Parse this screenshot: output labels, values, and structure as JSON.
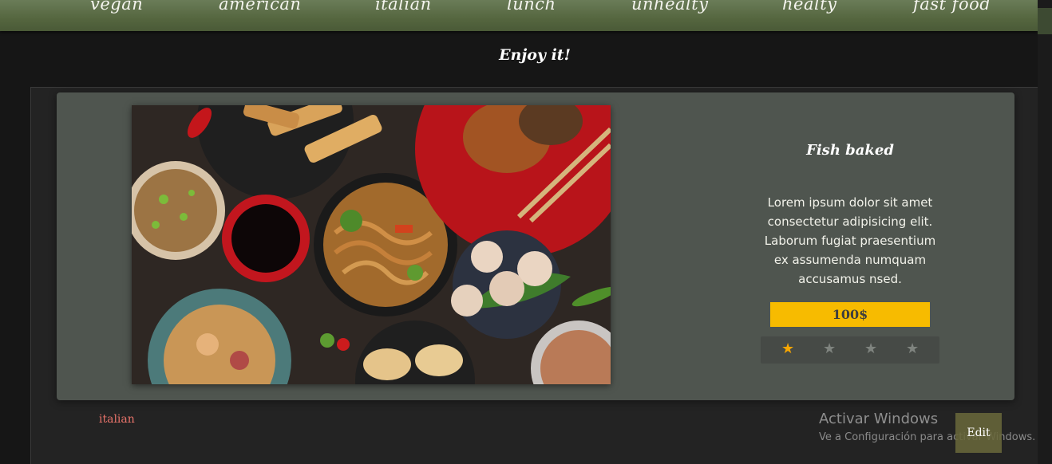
{
  "nav": {
    "items": [
      {
        "label": "vegan"
      },
      {
        "label": "american"
      },
      {
        "label": "italian"
      },
      {
        "label": "lunch"
      },
      {
        "label": "unhealty"
      },
      {
        "label": "healty"
      },
      {
        "label": "fast food"
      }
    ]
  },
  "page": {
    "title": "Enjoy it!"
  },
  "item": {
    "image_icon": "food-photo",
    "name": "Fish baked",
    "description": "Lorem ipsum dolor sit amet consectetur adipisicing elit. Laborum fugiat praesentium ex assumenda numquam accusamus nsed.",
    "price": "100$",
    "rating": {
      "value": 1,
      "max": 4,
      "filled_color": "#f7a600",
      "empty_color": "#7f847f"
    },
    "category": "italian"
  },
  "overlay": {
    "watermark_title": "Activar Windows",
    "watermark_subtitle": "Ve a Configuración para activar Windows."
  },
  "actions": {
    "edit_label": "Edit"
  },
  "colors": {
    "nav_bg": "#55663f",
    "card_bg": "#4f554f",
    "price_bg": "#f7bb00",
    "category_text": "#e8736a"
  }
}
